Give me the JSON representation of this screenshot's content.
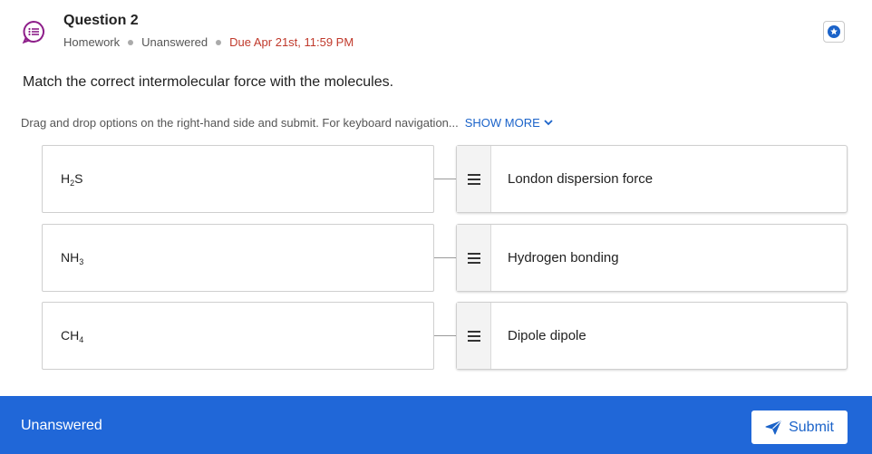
{
  "header": {
    "title": "Question 2",
    "type": "Homework",
    "status": "Unanswered",
    "due": "Due Apr 21st, 11:59 PM"
  },
  "prompt": "Match the correct intermolecular force with the molecules.",
  "instructions": {
    "text": "Drag and drop options on the right-hand side and submit. For keyboard navigation...",
    "show_more": "SHOW MORE"
  },
  "molecules": [
    {
      "base": "H",
      "sub": "2",
      "rest": "S"
    },
    {
      "base": "NH",
      "sub": "3",
      "rest": ""
    },
    {
      "base": "CH",
      "sub": "4",
      "rest": ""
    }
  ],
  "options": [
    {
      "label": "London dispersion force"
    },
    {
      "label": "Hydrogen bonding"
    },
    {
      "label": "Dipole dipole"
    }
  ],
  "footer": {
    "status": "Unanswered",
    "submit_label": "Submit"
  },
  "colors": {
    "accent": "#2067d8",
    "link": "#1b63c9",
    "due": "#c0392b",
    "question_icon": "#8e1f8a"
  }
}
